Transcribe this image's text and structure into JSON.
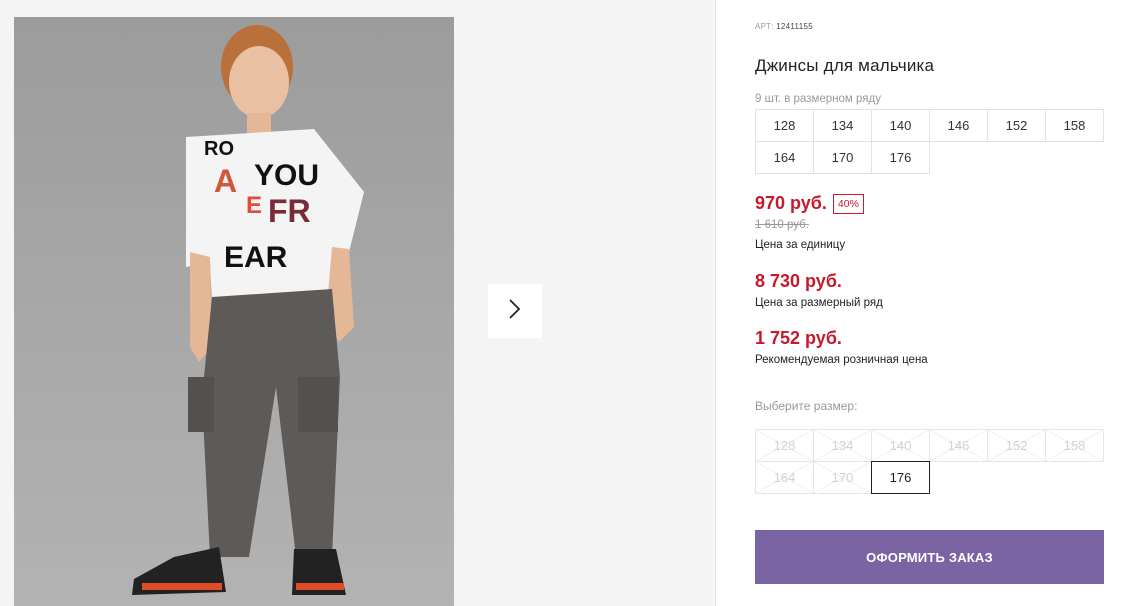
{
  "product": {
    "art_label": "АРТ:",
    "art_number": "12411155",
    "title": "Джинсы для мальчика"
  },
  "pack": {
    "label": "9 шт. в размерном ряду",
    "sizes": [
      "128",
      "134",
      "140",
      "146",
      "152",
      "158",
      "164",
      "170",
      "176"
    ]
  },
  "price": {
    "current": "970 руб.",
    "discount": "40%",
    "old": "1 610 руб.",
    "unit_label": "Цена за единицу",
    "pack_total": "8 730 руб.",
    "pack_label": "Цена за размерный ряд",
    "retail": "1 752 руб.",
    "retail_label": "Рекомендуемая розничная цена",
    "accent_color": "#c8192c"
  },
  "size_select": {
    "label": "Выберите размер:",
    "sizes": [
      "128",
      "134",
      "140",
      "146",
      "152",
      "158",
      "164",
      "170",
      "176"
    ],
    "selected": "176"
  },
  "gallery": {
    "next_icon": "chevron-right-icon",
    "photo_alt": "boy-in-jeans-photo"
  },
  "order_button": {
    "label": "ОФОРМИТЬ ЗАКАЗ",
    "color": "#7b64a3"
  }
}
